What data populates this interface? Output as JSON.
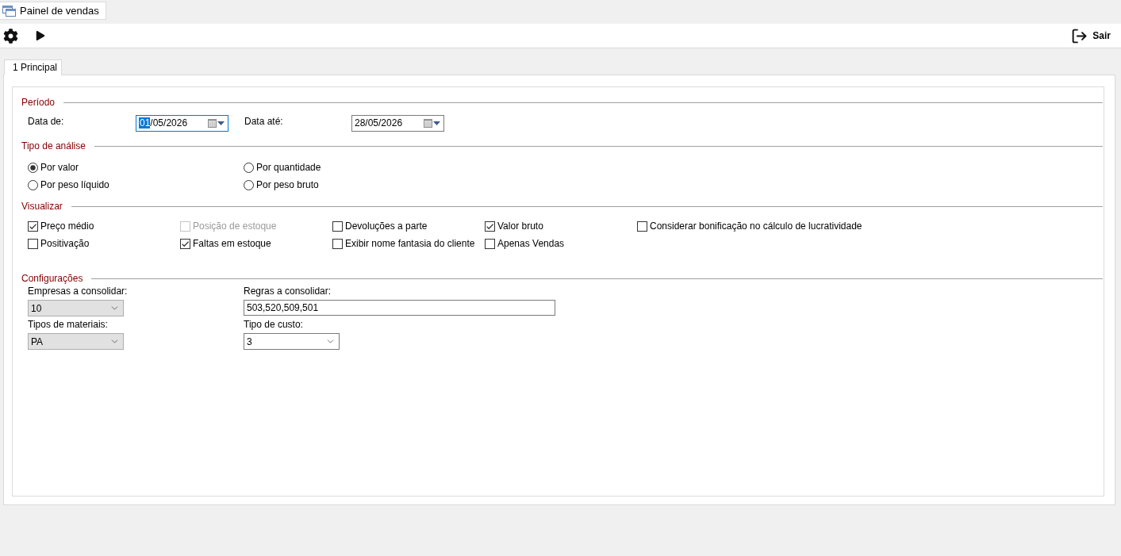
{
  "document_tabs": [
    {
      "label": "Painel de vendas",
      "selected": true
    }
  ],
  "toolbar": {
    "exit_button": {
      "label": "Sair"
    }
  },
  "page_tabs": [
    {
      "label": "1 Principal",
      "selected": true
    }
  ],
  "periodo": {
    "title": "Período",
    "fields": [
      {
        "label": "Data de:",
        "value": "01/05/2026",
        "focused": true
      },
      {
        "label": "Data até:",
        "value": "28/05/2026",
        "focused": false
      }
    ]
  },
  "tipo_de_analise": {
    "title": "Tipo de análise",
    "options": [
      {
        "label": "Por valor",
        "selected": true
      },
      {
        "label": "Por quantidade",
        "selected": false
      },
      {
        "label": "Por peso líquido",
        "selected": false
      },
      {
        "label": "Por peso bruto",
        "selected": false
      }
    ]
  },
  "visualizar": {
    "title": "Visualizar",
    "options": [
      {
        "label": "Preço médio",
        "checked": true,
        "disabled": false
      },
      {
        "label": "Posição de estoque",
        "checked": false,
        "disabled": true
      },
      {
        "label": "Devoluções a parte",
        "checked": false,
        "disabled": false
      },
      {
        "label": "Valor bruto",
        "checked": true,
        "disabled": false
      },
      {
        "label": "Considerar bonificação no cálculo de lucratividade",
        "checked": false,
        "disabled": false
      },
      {
        "label": "Positivação",
        "checked": false,
        "disabled": false
      },
      {
        "label": "Faltas em estoque",
        "checked": true,
        "disabled": false
      },
      {
        "label": "Exibir nome fantasia do cliente",
        "checked": false,
        "disabled": false
      },
      {
        "label": "Apenas Vendas",
        "checked": false,
        "disabled": false
      }
    ]
  },
  "configuracoes": {
    "title": "Configurações",
    "fields": [
      {
        "label": "Empresas a consolidar:",
        "kind": "dropdown",
        "value": "10"
      },
      {
        "label": "Regras a consolidar:",
        "kind": "text",
        "value": "503,520,509,501"
      },
      {
        "label": "Tipos de materiais:",
        "kind": "dropdown",
        "value": "PA"
      },
      {
        "label": "Tipo de custo:",
        "kind": "combo",
        "value": "3"
      }
    ]
  }
}
